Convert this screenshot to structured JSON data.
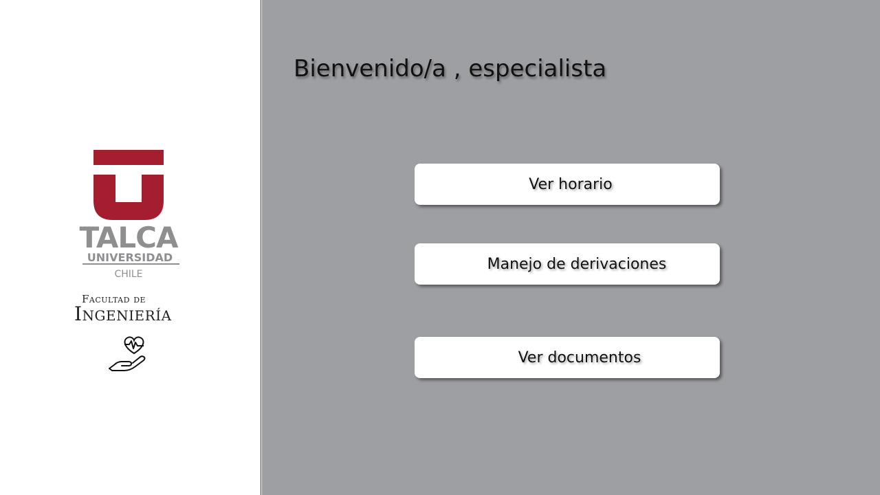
{
  "sidebar": {
    "logo": {
      "name": "TALCA",
      "subtitle": "UNIVERSIDAD",
      "country": "CHILE",
      "brand_color": "#a51e2f",
      "text_color": "#8f8f91"
    },
    "faculty": {
      "line1": "Facultad de",
      "line2": "Ingeniería"
    },
    "icon": "hand-heart-pulse-icon"
  },
  "main": {
    "background": "#9e9fa3",
    "title": "Bienvenido/a , especialista",
    "buttons": [
      {
        "label": "Ver horario"
      },
      {
        "label": "Manejo de derivaciones"
      },
      {
        "label": "Ver documentos"
      }
    ]
  }
}
